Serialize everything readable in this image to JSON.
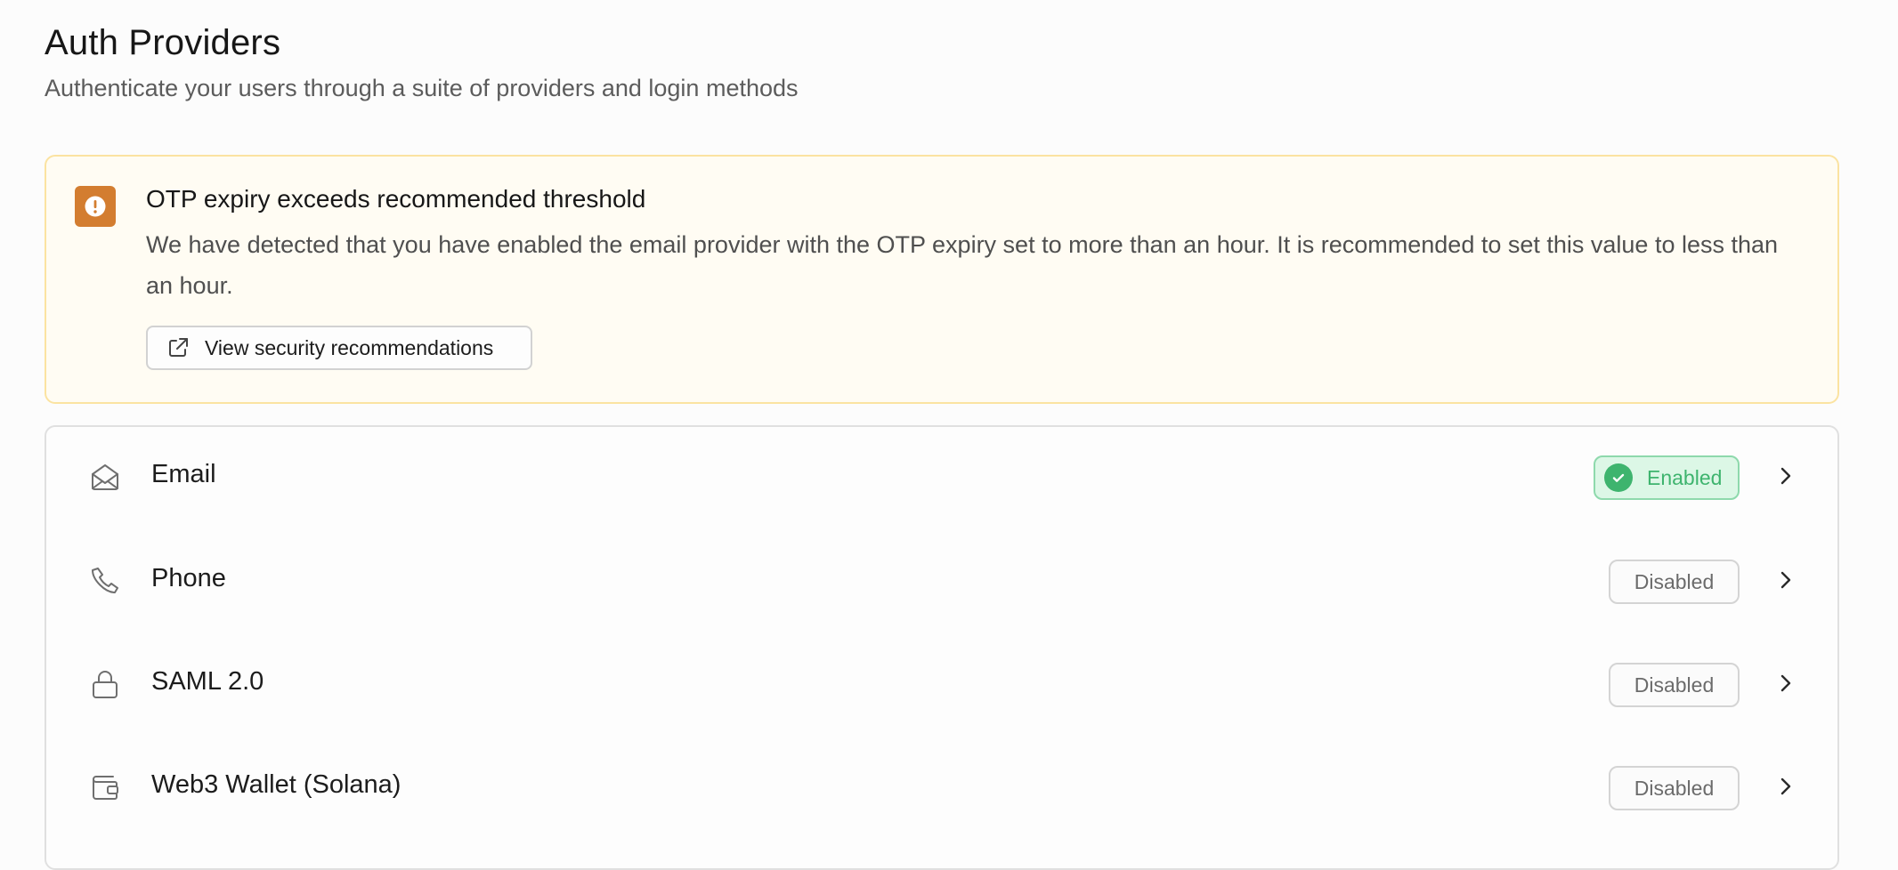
{
  "header": {
    "title": "Auth Providers",
    "subtitle": "Authenticate your users through a suite of providers and login methods"
  },
  "alert": {
    "icon": "exclamation-icon",
    "title": "OTP expiry exceeds recommended threshold",
    "body": "We have detected that you have enabled the email provider with the OTP expiry set to more than an hour. It is recommended to set this value to less than an hour.",
    "button_label": "View security recommendations",
    "button_icon": "external-link-icon",
    "accent_color": "#d37d30"
  },
  "providers": [
    {
      "label": "Email",
      "icon": "envelope-open-icon",
      "status": "Enabled"
    },
    {
      "label": "Phone",
      "icon": "phone-icon",
      "status": "Disabled"
    },
    {
      "label": "SAML 2.0",
      "icon": "lock-icon",
      "status": "Disabled"
    },
    {
      "label": "Web3 Wallet (Solana)",
      "icon": "wallet-icon",
      "status": "Disabled"
    }
  ],
  "colors": {
    "enabled": "#3eb46e",
    "warning_bg": "#fffcf3",
    "warning_border": "#fbe3a1"
  }
}
